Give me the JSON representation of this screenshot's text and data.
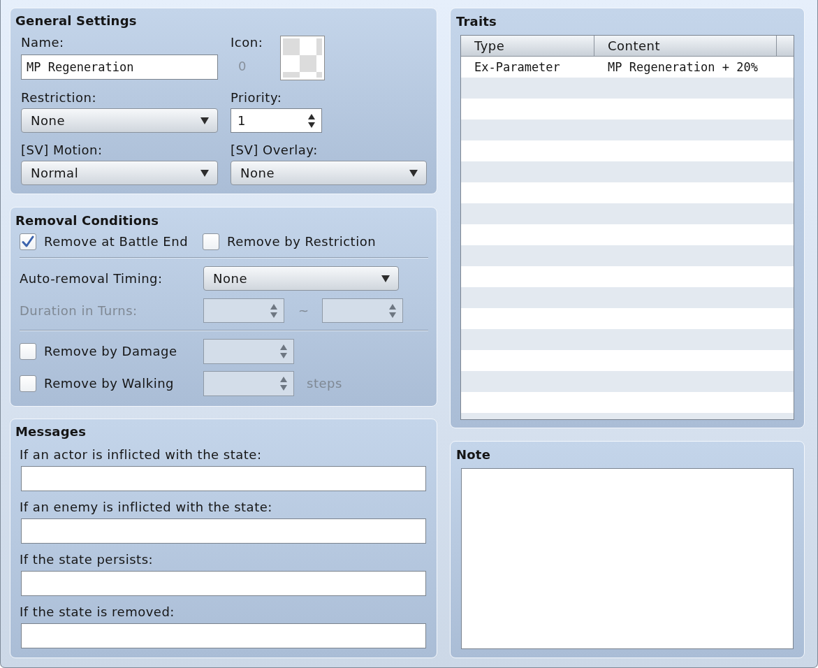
{
  "general_settings": {
    "title": "General Settings",
    "name": {
      "label": "Name:",
      "value": "MP Regeneration"
    },
    "icon": {
      "label": "Icon:",
      "index": "0"
    },
    "restriction": {
      "label": "Restriction:",
      "value": "None"
    },
    "priority": {
      "label": "Priority:",
      "value": "1"
    },
    "sv_motion": {
      "label": "[SV] Motion:",
      "value": "Normal"
    },
    "sv_overlay": {
      "label": "[SV] Overlay:",
      "value": "None"
    }
  },
  "removal_conditions": {
    "title": "Removal Conditions",
    "checkboxes": [
      {
        "label": "Remove at Battle End",
        "checked": true
      },
      {
        "label": "Remove by Restriction",
        "checked": false
      }
    ],
    "auto_removal_timing": {
      "label": "Auto-removal Timing:",
      "value": "None"
    },
    "duration_in_turns": {
      "label": "Duration in Turns:",
      "disabled": true,
      "separator": "~"
    },
    "step_conditions": [
      {
        "label": "Remove by Damage",
        "checked": false,
        "disabled": true
      },
      {
        "label": "Remove by Walking",
        "checked": false,
        "disabled": true,
        "unit": "steps"
      }
    ]
  },
  "messages": {
    "title": "Messages",
    "fields": [
      {
        "label": "If an actor is inflicted with the state:"
      },
      {
        "label": "If an enemy is inflicted with the state:"
      },
      {
        "label": "If the state persists:"
      },
      {
        "label": "If the state is removed:"
      }
    ]
  },
  "traits": {
    "title": "Traits",
    "columns": [
      "Type",
      "Content"
    ],
    "rows": [
      {
        "type": "Ex-Parameter",
        "content": "MP Regeneration + 20%"
      }
    ]
  },
  "note": {
    "title": "Note"
  }
}
